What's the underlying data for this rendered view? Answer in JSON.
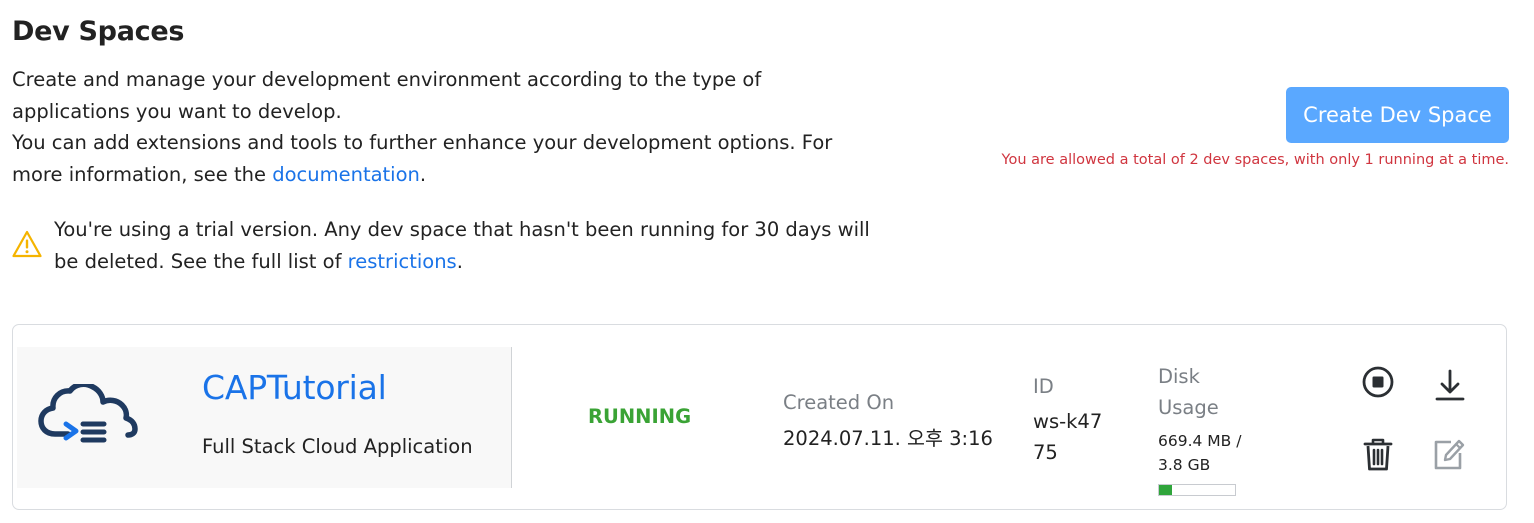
{
  "header": {
    "title": "Dev Spaces",
    "intro_line1": "Create and manage your development environment according to the type of applications you want to develop.",
    "intro_line2_prefix": "You can add extensions and tools to further enhance your development options. For more information, see the ",
    "intro_link": "documentation",
    "intro_line2_suffix": "."
  },
  "trial": {
    "icon": "warning-icon",
    "text_prefix": "You're using a trial version. Any dev space that hasn't been running for 30 days will be deleted. See the full list of ",
    "link": "restrictions",
    "text_suffix": "."
  },
  "actions": {
    "create_label": "Create Dev Space",
    "limit_note": "You are allowed a total of 2 dev spaces, with only 1 running at a time."
  },
  "dev_space": {
    "icon": "cloud-code-icon",
    "name": "CAPTutorial",
    "type": "Full Stack Cloud Application",
    "status": "RUNNING",
    "created_label": "Created On",
    "created_value": "2024.07.11. 오후 3:16",
    "id_label": "ID",
    "id_value": "ws-k4775",
    "disk_label": "Disk Usage",
    "disk_value": "669.4 MB / 3.8 GB",
    "disk_usage_fraction": 0.172,
    "icons": [
      "stop-icon",
      "download-icon",
      "trash-icon",
      "edit-icon"
    ]
  },
  "colors": {
    "accent": "#1a73e8",
    "button": "#5aa8ff",
    "status_running": "#3aa335",
    "warning": "#f5b400",
    "error_text": "#d0353f",
    "disk_fill": "#2fa53b",
    "icon_dark": "#1f3a60"
  }
}
